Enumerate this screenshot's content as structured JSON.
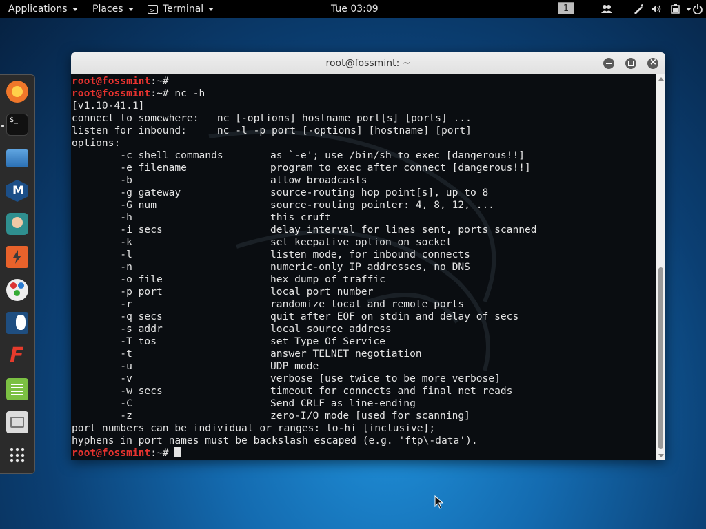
{
  "topbar": {
    "applications": "Applications",
    "places": "Places",
    "terminal": "Terminal",
    "clock": "Tue 03:09",
    "workspace": "1",
    "tray_icons": [
      "people-icon",
      "pen-tool-icon",
      "volume-icon",
      "battery-icon"
    ]
  },
  "dock": {
    "items": [
      "firefox-icon",
      "terminal-icon",
      "files-icon",
      "metasploit-icon",
      "armitage-icon",
      "burpsuite-icon",
      "maltego-icon",
      "beef-icon",
      "faraday-icon",
      "leafpad-icon",
      "screenshot-icon",
      "show-apps-icon"
    ]
  },
  "window": {
    "title": "root@fossmint: ~"
  },
  "prompt": {
    "user": "root@fossmint",
    "path": ":~#"
  },
  "terminal": {
    "command": " nc -h",
    "version": "[v1.10-41.1]",
    "usage": [
      "connect to somewhere:   nc [-options] hostname port[s] [ports] ...",
      "listen for inbound:     nc -l -p port [-options] [hostname] [port]",
      "options:"
    ],
    "options": [
      {
        "flag": "        -c shell commands",
        "desc": "as `-e'; use /bin/sh to exec [dangerous!!]"
      },
      {
        "flag": "        -e filename",
        "desc": "program to exec after connect [dangerous!!]"
      },
      {
        "flag": "        -b",
        "desc": "allow broadcasts"
      },
      {
        "flag": "        -g gateway",
        "desc": "source-routing hop point[s], up to 8"
      },
      {
        "flag": "        -G num",
        "desc": "source-routing pointer: 4, 8, 12, ..."
      },
      {
        "flag": "        -h",
        "desc": "this cruft"
      },
      {
        "flag": "        -i secs",
        "desc": "delay interval for lines sent, ports scanned"
      },
      {
        "flag": "        -k",
        "desc": "set keepalive option on socket"
      },
      {
        "flag": "        -l",
        "desc": "listen mode, for inbound connects"
      },
      {
        "flag": "        -n",
        "desc": "numeric-only IP addresses, no DNS"
      },
      {
        "flag": "        -o file",
        "desc": "hex dump of traffic"
      },
      {
        "flag": "        -p port",
        "desc": "local port number"
      },
      {
        "flag": "        -r",
        "desc": "randomize local and remote ports"
      },
      {
        "flag": "        -q secs",
        "desc": "quit after EOF on stdin and delay of secs"
      },
      {
        "flag": "        -s addr",
        "desc": "local source address"
      },
      {
        "flag": "        -T tos",
        "desc": "set Type Of Service"
      },
      {
        "flag": "        -t",
        "desc": "answer TELNET negotiation"
      },
      {
        "flag": "        -u",
        "desc": "UDP mode"
      },
      {
        "flag": "        -v",
        "desc": "verbose [use twice to be more verbose]"
      },
      {
        "flag": "        -w secs",
        "desc": "timeout for connects and final net reads"
      },
      {
        "flag": "        -C",
        "desc": "Send CRLF as line-ending"
      },
      {
        "flag": "        -z",
        "desc": "zero-I/O mode [used for scanning]"
      }
    ],
    "footer": [
      "port numbers can be individual or ranges: lo-hi [inclusive];",
      "hyphens in port names must be backslash escaped (e.g. 'ftp\\-data')."
    ]
  }
}
